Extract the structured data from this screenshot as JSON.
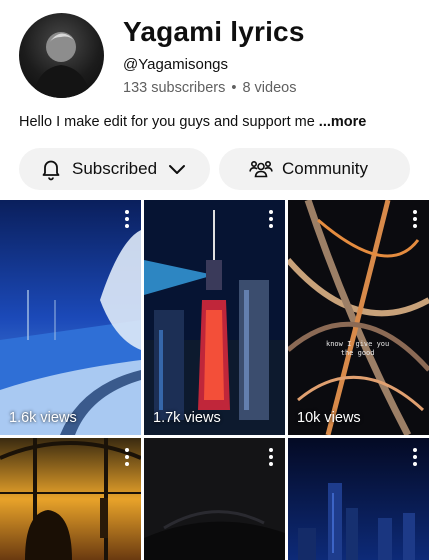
{
  "channel": {
    "name": "Yagami lyrics",
    "handle": "@Yagamisongs",
    "subscribers": "133 subscribers",
    "separator": "•",
    "videos": "8 videos",
    "description": "Hello I make edit for you guys and support me",
    "more_label": "...more"
  },
  "buttons": {
    "subscribed_label": "Subscribed",
    "subscribed_icon": "bell-icon",
    "dropdown_icon": "chevron-down-icon",
    "community_label": "Community",
    "community_icon": "people-icon"
  },
  "videos": [
    {
      "views": "1.6k views",
      "theme": "snowy-blue-road"
    },
    {
      "views": "1.7k views",
      "theme": "city-tower-night"
    },
    {
      "views": "10k views",
      "theme": "highway-interchange",
      "overlay_text": [
        "know I give you",
        "the good"
      ]
    },
    {
      "views": "",
      "theme": "sunset-window-silhouette"
    },
    {
      "views": "",
      "theme": "dark-car-night"
    },
    {
      "views": "",
      "theme": "city-skyline-blue"
    }
  ],
  "colors": {
    "button_bg": "#f2f2f2",
    "secondary_text": "#606060",
    "primary_text": "#0f0f0f"
  }
}
